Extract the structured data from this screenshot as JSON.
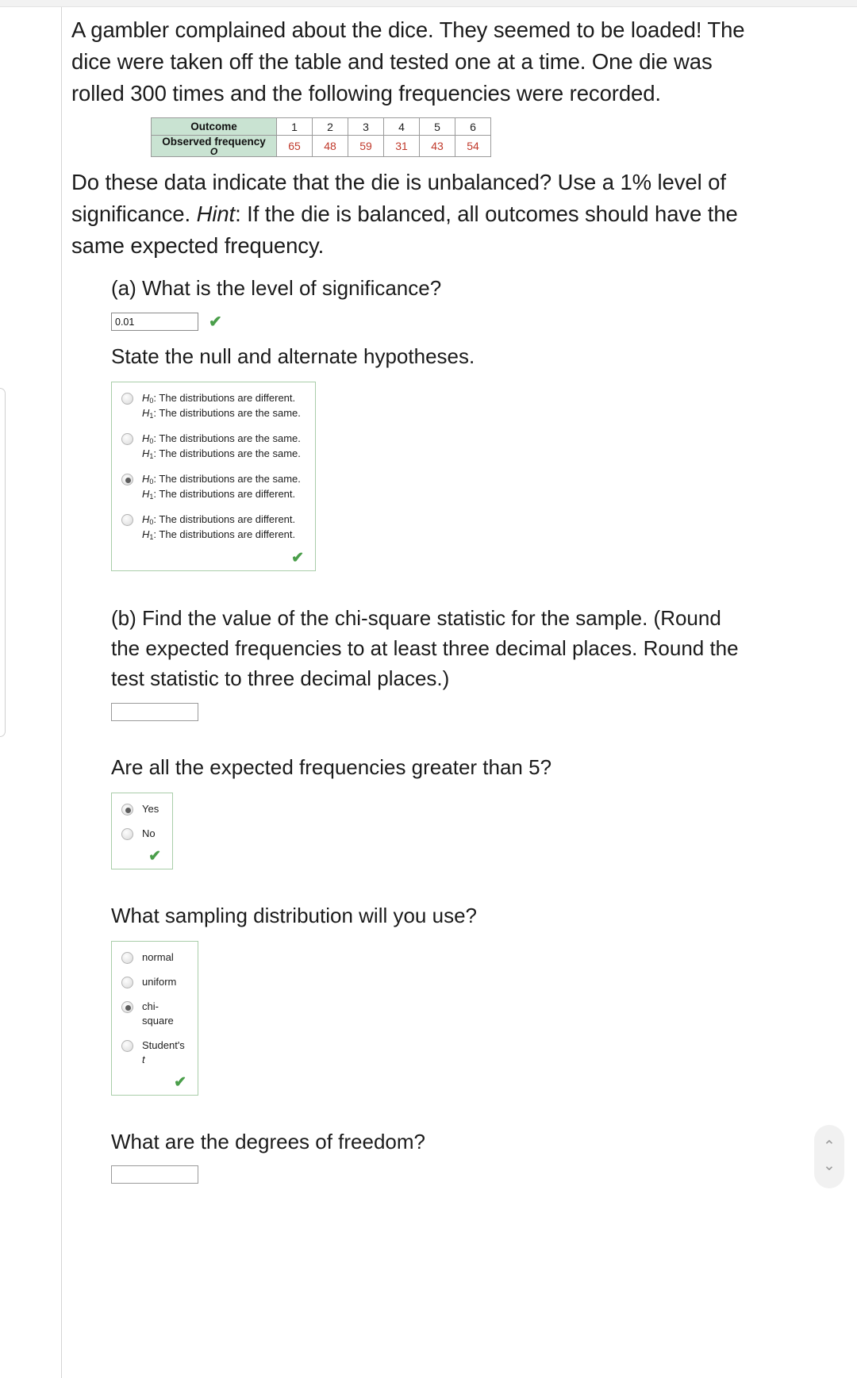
{
  "problem": {
    "intro": "A gambler complained about the dice. They seemed to be loaded! The dice were taken off the table and tested one at a time. One die was rolled 300 times and the following frequencies were recorded.",
    "question_pre_hint": "Do these data indicate that the die is unbalanced? Use a 1% level of significance. ",
    "hint_word": "Hint",
    "question_post_hint": ": If the die is balanced, all outcomes should have the same expected frequency."
  },
  "table": {
    "row_label_outcome": "Outcome",
    "row_label_observed": "Observed frequency",
    "row_label_observed_sub": "O",
    "outcomes": [
      "1",
      "2",
      "3",
      "4",
      "5",
      "6"
    ],
    "observed": [
      "65",
      "48",
      "59",
      "31",
      "43",
      "54"
    ],
    "header_bg": "#c9e3d2",
    "value_color": "#c0392b"
  },
  "part_a": {
    "prompt": "(a) What is the level of significance?",
    "answer_value": "0.01",
    "tick": "✔",
    "hypotheses_prompt": "State the null and alternate hypotheses.",
    "options": [
      {
        "h0": "H0: The distributions are different.",
        "h1": "H1: The distributions are the same.",
        "selected": false
      },
      {
        "h0": "H0: The distributions are the same.",
        "h1": "H1: The distributions are the same.",
        "selected": false
      },
      {
        "h0": "H0: The distributions are the same.",
        "h1": "H1: The distributions are different.",
        "selected": true
      },
      {
        "h0": "H0: The distributions are different.",
        "h1": "H1: The distributions are different.",
        "selected": false
      }
    ],
    "group_tick": "✔"
  },
  "part_b": {
    "prompt": "(b) Find the value of the chi-square statistic for the sample. (Round the expected frequencies to at least three decimal places. Round the test statistic to three decimal places.)",
    "answer_value": "",
    "expected_prompt": "Are all the expected frequencies greater than 5?",
    "yesno_options": [
      {
        "label": "Yes",
        "selected": true
      },
      {
        "label": "No",
        "selected": false
      }
    ],
    "yesno_tick": "✔",
    "dist_prompt": "What sampling distribution will you use?",
    "dist_options": [
      {
        "label": "normal",
        "selected": false
      },
      {
        "label": "uniform",
        "selected": false
      },
      {
        "label": "chi-square",
        "selected": true
      },
      {
        "label": "Student's t",
        "selected": false,
        "italic_tail": true
      }
    ],
    "dist_tick": "✔",
    "df_prompt": "What are the degrees of freedom?",
    "df_value": ""
  },
  "scroll": {
    "up": "⌃",
    "down": "⌄"
  }
}
